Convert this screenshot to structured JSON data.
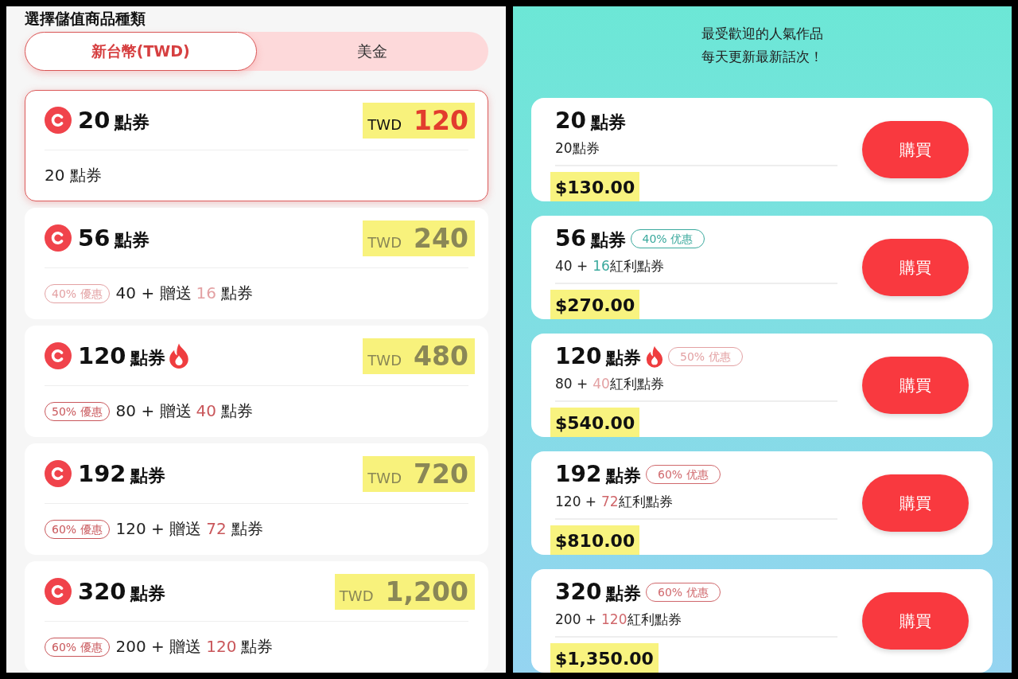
{
  "left_panel": {
    "title": "選擇儲值商品種類",
    "currency_tabs": [
      {
        "label": "新台幣(TWD)",
        "selected": true
      },
      {
        "label": "美金",
        "selected": false
      }
    ],
    "packages": [
      {
        "amount": "20",
        "unit": "點券",
        "hot": false,
        "selected": true,
        "currency": "TWD",
        "price": "120",
        "price_highlighted": true,
        "description": {
          "base": "20 點券"
        }
      },
      {
        "amount": "56",
        "unit": "點券",
        "hot": false,
        "selected": false,
        "currency": "TWD",
        "price": "240",
        "price_highlighted": true,
        "tag": {
          "label": "40% 優惠",
          "color": "#e3a1a3"
        },
        "description": {
          "base": "40 + 贈送",
          "bonus": "16",
          "unit": "點券"
        }
      },
      {
        "amount": "120",
        "unit": "點券",
        "hot": true,
        "selected": false,
        "currency": "TWD",
        "price": "480",
        "price_highlighted": true,
        "tag": {
          "label": "50% 優惠",
          "color": "#c9575b"
        },
        "description": {
          "base": "80 + 贈送",
          "bonus": "40",
          "unit": "點券"
        }
      },
      {
        "amount": "192",
        "unit": "點券",
        "hot": false,
        "selected": false,
        "currency": "TWD",
        "price": "720",
        "price_highlighted": true,
        "tag": {
          "label": "60% 優惠",
          "color": "#c9575b"
        },
        "description": {
          "base": "120 + 贈送",
          "bonus": "72",
          "unit": "點券"
        }
      },
      {
        "amount": "320",
        "unit": "點券",
        "hot": false,
        "selected": false,
        "currency": "TWD",
        "price": "1,200",
        "price_highlighted": true,
        "tag": {
          "label": "60% 優惠",
          "color": "#c9575b"
        },
        "description": {
          "base": "200 + 贈送",
          "bonus": "120",
          "unit": "點券"
        }
      }
    ]
  },
  "right_panel": {
    "headline": [
      "最受歡迎的人氣作品",
      "每天更新最新話次！"
    ],
    "packages": [
      {
        "amount": "20",
        "unit": "點券",
        "hot": false,
        "description": {
          "base": "20點券"
        },
        "price": "$130.00",
        "price_highlighted": true,
        "button": "購買"
      },
      {
        "amount": "56",
        "unit": "點券",
        "hot": false,
        "tag": {
          "label": "40% 优惠",
          "color": "#3aa99d"
        },
        "description": {
          "base": "40 +",
          "bonus": "16",
          "unit": "紅利點券"
        },
        "price": "$270.00",
        "price_highlighted": true,
        "button": "購買"
      },
      {
        "amount": "120",
        "unit": "點券",
        "hot": true,
        "tag": {
          "label": "50% 优惠",
          "color": "#e3a1a3"
        },
        "description": {
          "base": "80 +",
          "bonus": "40",
          "unit": "紅利點券"
        },
        "price": "$540.00",
        "price_highlighted": true,
        "button": "購買"
      },
      {
        "amount": "192",
        "unit": "點券",
        "hot": false,
        "tag": {
          "label": "60% 优惠",
          "color": "#d0686c"
        },
        "description": {
          "base": "120 +",
          "bonus": "72",
          "unit": "紅利點券"
        },
        "price": "$810.00",
        "price_highlighted": true,
        "button": "購買"
      },
      {
        "amount": "320",
        "unit": "點券",
        "hot": false,
        "tag": {
          "label": "60% 优惠",
          "color": "#d0686c"
        },
        "description": {
          "base": "200 +",
          "bonus": "120",
          "unit": "紅利點券"
        },
        "price": "$1,350.00",
        "price_highlighted": true,
        "button": "購買"
      }
    ]
  }
}
